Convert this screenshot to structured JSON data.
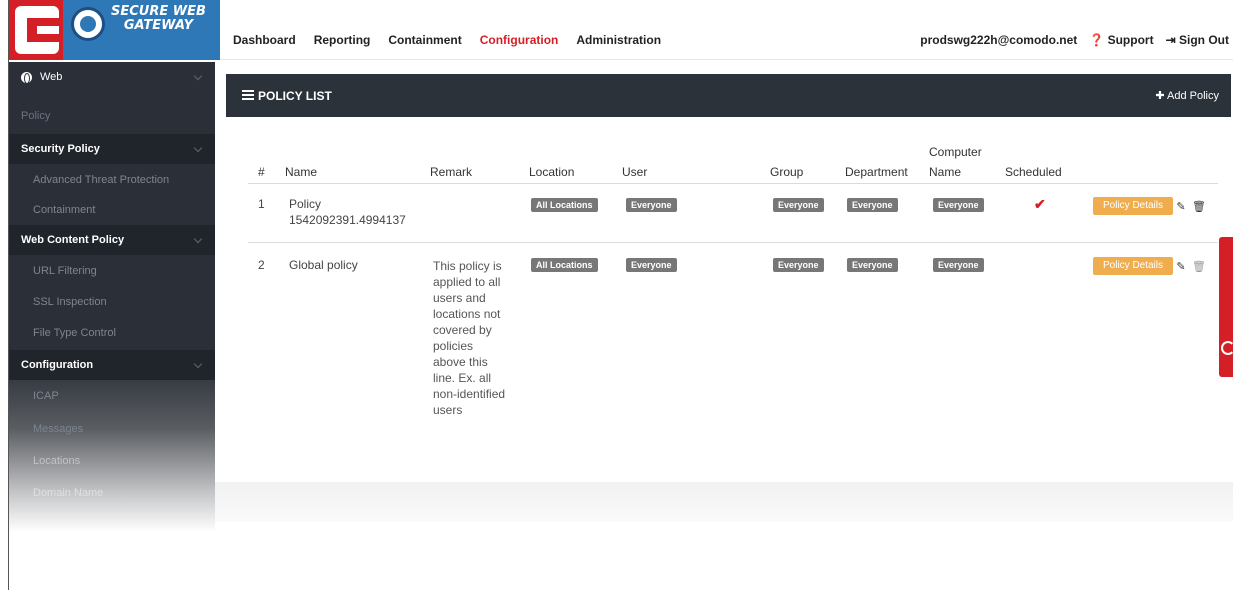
{
  "brand": {
    "line1": "SECURE WEB",
    "line2": "GATEWAY"
  },
  "topnav": [
    "Dashboard",
    "Reporting",
    "Containment",
    "Configuration",
    "Administration"
  ],
  "topnav_active": "Configuration",
  "topright": {
    "user": "prodswg222h@comodo.net",
    "support": "Support",
    "signout": "Sign Out"
  },
  "sidebar": {
    "web": "Web",
    "policy": "Policy",
    "security_policy": "Security Policy",
    "atp": "Advanced Threat Protection",
    "containment": "Containment",
    "web_content_policy": "Web Content Policy",
    "url_filtering": "URL Filtering",
    "ssl_inspection": "SSL Inspection",
    "file_type_control": "File Type Control",
    "configuration": "Configuration",
    "icap": "ICAP",
    "messages": "Messages",
    "locations": "Locations",
    "domain_name": "Domain Name"
  },
  "panel": {
    "title": "POLICY LIST",
    "add": "Add Policy"
  },
  "table": {
    "headers": {
      "num": "#",
      "name": "Name",
      "remark": "Remark",
      "location": "Location",
      "user": "User",
      "group": "Group",
      "department": "Department",
      "computer_1": "Computer",
      "computer_2": "Name",
      "scheduled": "Scheduled"
    },
    "rows": [
      {
        "num": "1",
        "name_1": "Policy",
        "name_2": "1542092391.4994137",
        "remark": "",
        "location": "All Locations",
        "user": "Everyone",
        "group": "Everyone",
        "department": "Everyone",
        "computer": "Everyone",
        "scheduled": "✔",
        "details": "Policy Details"
      },
      {
        "num": "2",
        "name_1": "Global policy",
        "remark_lines": [
          "This policy is",
          "applied to all",
          "users and",
          "locations not",
          "covered by",
          "policies",
          "above this",
          "line. Ex. all",
          "non-identified",
          "users"
        ],
        "location": "All Locations",
        "user": "Everyone",
        "group": "Everyone",
        "department": "Everyone",
        "computer": "Everyone",
        "details": "Policy Details"
      }
    ]
  },
  "colors": {
    "accent": "#d41f26",
    "sidebar": "#2b3038",
    "button": "#f0ad4e"
  }
}
